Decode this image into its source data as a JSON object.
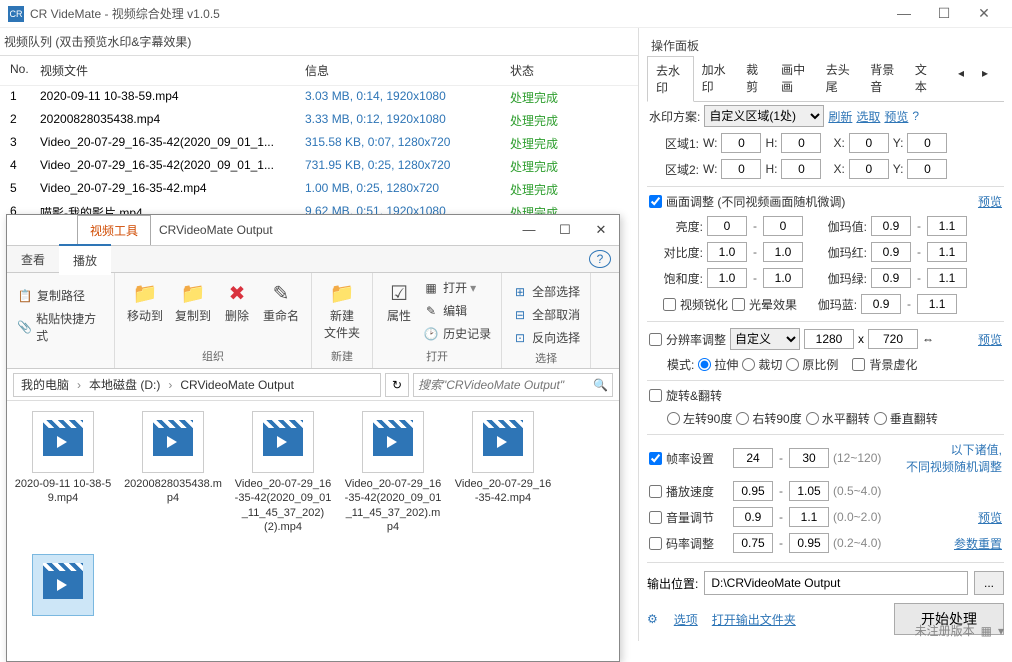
{
  "app": {
    "title": "CR VideMate - 视频综合处理 v1.0.5"
  },
  "left_panel": {
    "title": "视频队列 (双击预览水印&字幕效果)",
    "columns": {
      "no": "No.",
      "file": "视频文件",
      "info": "信息",
      "status": "状态"
    },
    "rows": [
      {
        "no": "1",
        "file": "2020-09-11 10-38-59.mp4",
        "info": "3.03 MB, 0:14, 1920x1080",
        "status": "处理完成"
      },
      {
        "no": "2",
        "file": "20200828035438.mp4",
        "info": "3.33 MB, 0:12, 1920x1080",
        "status": "处理完成"
      },
      {
        "no": "3",
        "file": "Video_20-07-29_16-35-42(2020_09_01_1...",
        "info": "315.58 KB, 0:07, 1280x720",
        "status": "处理完成"
      },
      {
        "no": "4",
        "file": "Video_20-07-29_16-35-42(2020_09_01_1...",
        "info": "731.95 KB, 0:25, 1280x720",
        "status": "处理完成"
      },
      {
        "no": "5",
        "file": "Video_20-07-29_16-35-42.mp4",
        "info": "1.00 MB, 0:25, 1280x720",
        "status": "处理完成"
      },
      {
        "no": "6",
        "file": "喵影-我的影片.mp4",
        "info": "9.62 MB, 0:51, 1920x1080",
        "status": "处理完成"
      }
    ]
  },
  "explorer": {
    "tab_label": "视频工具",
    "title": "CRVideoMate Output",
    "menus": {
      "view": "查看",
      "play": "播放"
    },
    "ribbon": {
      "copy_path": "复制路径",
      "paste_shortcut": "粘贴快捷方式",
      "move_to": "移动到",
      "copy_to": "复制到",
      "delete": "删除",
      "rename": "重命名",
      "new_folder": "新建\n文件夹",
      "properties": "属性",
      "open": "打开",
      "edit": "编辑",
      "history": "历史记录",
      "select_all": "全部选择",
      "select_none": "全部取消",
      "invert": "反向选择",
      "group_org": "组织",
      "group_new": "新建",
      "group_open": "打开",
      "group_select": "选择"
    },
    "breadcrumb": {
      "pc": "我的电脑",
      "drive": "本地磁盘 (D:)",
      "folder": "CRVideoMate Output"
    },
    "search_placeholder": "搜索\"CRVideoMate Output\"",
    "files": [
      "2020-09-11 10-38-59.mp4",
      "20200828035438.mp4",
      "Video_20-07-29_16-35-42(2020_09_01_11_45_37_202) (2).mp4",
      "Video_20-07-29_16-35-42(2020_09_01_11_45_37_202).mp4",
      "Video_20-07-29_16-35-42.mp4"
    ]
  },
  "right": {
    "title": "操作面板",
    "tabs": [
      "去水印",
      "加水印",
      "裁剪",
      "画中画",
      "去头尾",
      "背景音",
      "文本"
    ],
    "watermark_scheme_label": "水印方案:",
    "watermark_scheme_value": "自定义区域(1处)",
    "refresh": "刷新",
    "select": "选取",
    "preview": "预览",
    "region1_label": "区域1:",
    "region2_label": "区域2:",
    "W": "W:",
    "H": "H:",
    "X": "X:",
    "Y": "Y:",
    "region1": {
      "w": "0",
      "h": "0",
      "x": "0",
      "y": "0"
    },
    "region2": {
      "w": "0",
      "h": "0",
      "x": "0",
      "y": "0"
    },
    "picture_adjust": "画面调整 (不同视频画面随机微调)",
    "brightness": "亮度:",
    "contrast": "对比度:",
    "saturation": "饱和度:",
    "bright_v": {
      "a": "0",
      "b": "0"
    },
    "contrast_v": {
      "a": "1.0",
      "b": "1.0"
    },
    "sat_v": {
      "a": "1.0",
      "b": "1.0"
    },
    "gamma": "伽玛值:",
    "gamma_r": "伽玛红:",
    "gamma_g": "伽玛绿:",
    "gamma_b": "伽玛蓝:",
    "gamma_v": {
      "a": "0.9",
      "b": "1.1"
    },
    "gamma_r_v": {
      "a": "0.9",
      "b": "1.1"
    },
    "gamma_g_v": {
      "a": "0.9",
      "b": "1.1"
    },
    "gamma_b_v": {
      "a": "0.9",
      "b": "1.1"
    },
    "sharpen": "视频锐化",
    "halo": "光晕效果",
    "resolution": "分辨率调整",
    "custom": "自定义",
    "res_w": "1280",
    "res_h": "720",
    "mode": "模式:",
    "stretch": "拉伸",
    "crop": "裁切",
    "ratio": "原比例",
    "bg_blur": "背景虚化",
    "rotate": "旋转&翻转",
    "rot_l": "左转90度",
    "rot_r": "右转90度",
    "flip_h": "水平翻转",
    "flip_v": "垂直翻转",
    "fps": "帧率设置",
    "fps_a": "24",
    "fps_b": "30",
    "fps_hint": "(12~120)",
    "speed": "播放速度",
    "speed_a": "0.95",
    "speed_b": "1.05",
    "speed_hint": "(0.5~4.0)",
    "volume": "音量调节",
    "vol_a": "0.9",
    "vol_b": "1.1",
    "vol_hint": "(0.0~2.0)",
    "bitrate": "码率调整",
    "br_a": "0.75",
    "br_b": "0.95",
    "br_hint": "(0.2~4.0)",
    "random_hint1": "以下诸值,",
    "random_hint2": "不同视频随机调整",
    "reset_params": "参数重置",
    "output_label": "输出位置:",
    "output_path": "D:\\CRVideoMate Output",
    "options": "选项",
    "open_output": "打开输出文件夹",
    "start": "开始处理",
    "unregistered": "未注册版本"
  }
}
